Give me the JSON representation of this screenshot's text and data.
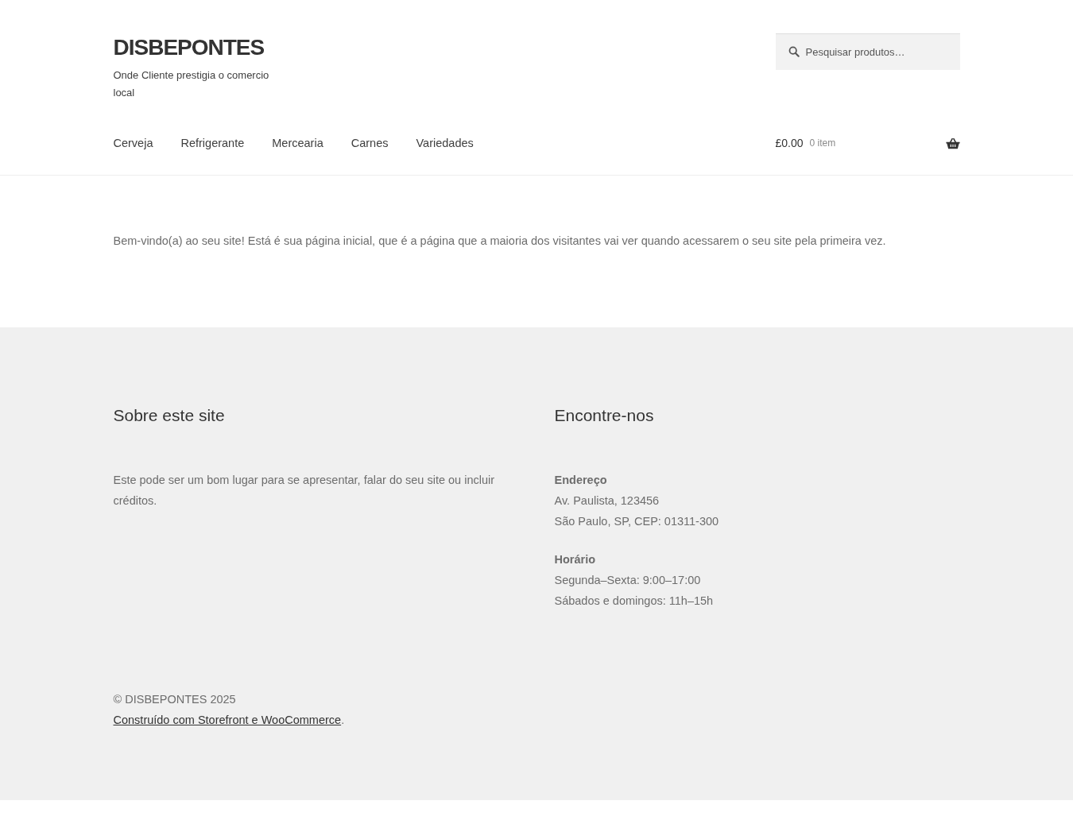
{
  "header": {
    "site_title": "DISBEPONTES",
    "tagline": "Onde Cliente prestigia o comercio local",
    "search": {
      "placeholder": "Pesquisar produtos…"
    }
  },
  "nav": {
    "items": [
      {
        "label": "Cerveja"
      },
      {
        "label": "Refrigerante"
      },
      {
        "label": "Mercearia"
      },
      {
        "label": "Carnes"
      },
      {
        "label": "Variedades"
      }
    ],
    "cart": {
      "total": "£0.00",
      "count": "0 item"
    }
  },
  "content": {
    "text": "Bem-vindo(a) ao seu site! Está é sua página inicial, que é a página que a maioria dos visitantes vai ver quando acessarem o seu site pela primeira vez."
  },
  "footer": {
    "widgets": [
      {
        "title": "Sobre este site",
        "paragraphs": [
          {
            "text": "Este pode ser um bom lugar para se apresentar, falar do seu site ou incluir créditos."
          }
        ]
      },
      {
        "title": "Encontre-nos",
        "blocks": [
          {
            "heading": "Endereço",
            "lines": [
              "Av. Paulista, 123456",
              "São Paulo, SP, CEP: 01311-300"
            ]
          },
          {
            "heading": "Horário",
            "lines": [
              "Segunda–Sexta: 9:00–17:00",
              "Sábados e domingos: 11h–15h"
            ]
          }
        ]
      }
    ],
    "copyright": "© DISBEPONTES 2025",
    "credit_link": "Construído com Storefront e WooCommerce",
    "credit_suffix": "."
  }
}
